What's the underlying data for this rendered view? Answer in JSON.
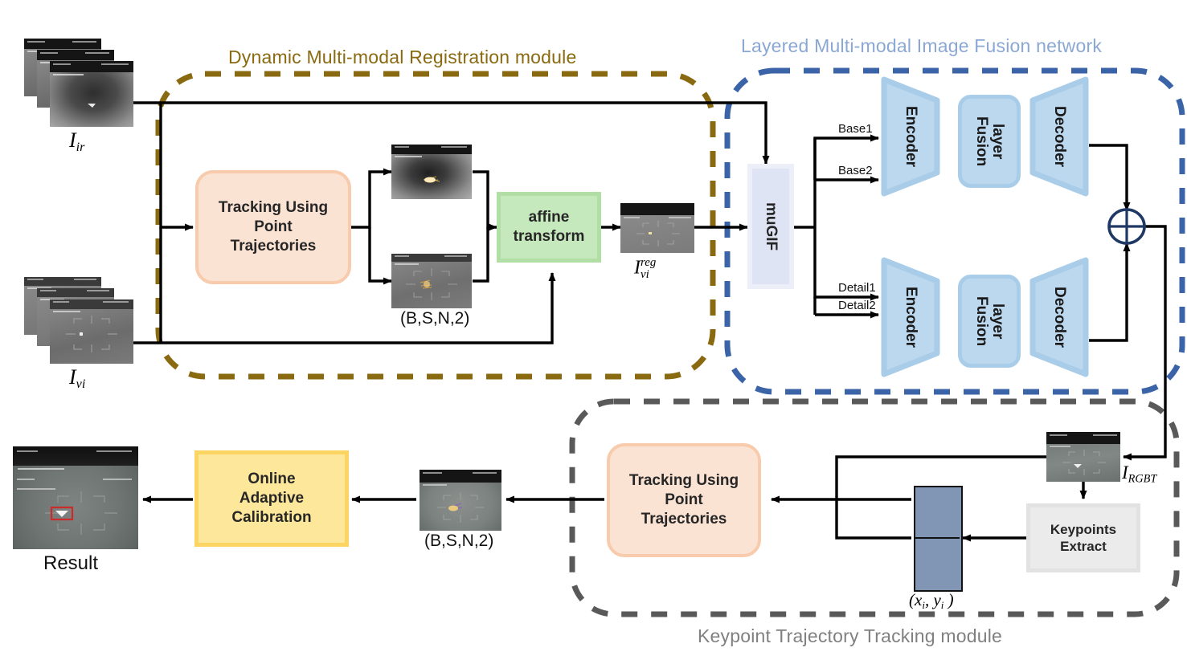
{
  "modules": [
    {
      "id": "registration",
      "caption": "Dynamic Multi-modal Registration module",
      "color": "#8a6a10"
    },
    {
      "id": "fusion",
      "caption": "Layered Multi-modal Image Fusion network",
      "color": "#8ba7d4"
    },
    {
      "id": "keypoint",
      "caption": "Keypoint Trajectory Tracking module",
      "color": "#808080"
    }
  ],
  "inputs": {
    "ir_label": "I",
    "ir_sub": "ir",
    "vi_label": "I",
    "vi_sub": "vi"
  },
  "registration": {
    "tracking_box": "Tracking Using Point Trajectories",
    "tracking_line1": "Tracking Using",
    "tracking_line2": "Point",
    "tracking_line3": "Trajectories",
    "affine_line1": "affine",
    "affine_line2": "transform",
    "tensor_label": "(B,S,N,2)",
    "reg_label": "I",
    "reg_sub": "vi",
    "reg_sup": "reg"
  },
  "fusion": {
    "mugif_label": "muGIF",
    "edge_labels": [
      "Base1",
      "Base2",
      "Detail1",
      "Detail2"
    ],
    "encoder_label": "Encoder",
    "fusion_layer_line1": "Fusion",
    "fusion_layer_line2": "layer",
    "decoder_label": "Decoder",
    "sum_symbol": "+",
    "output_label": "I",
    "output_sub": "RGBT"
  },
  "keypoint": {
    "tracking_line1": "Tracking Using",
    "tracking_line2": "Point",
    "tracking_line3": "Trajectories",
    "keypoints_line1": "Keypoints",
    "keypoints_line2": "Extract",
    "coords_label": "(x",
    "coords_sub1": "i",
    "coords_mid": ", y",
    "coords_sub2": "i",
    "coords_end": " )",
    "tensor_label": "(B,S,N,2)"
  },
  "output": {
    "calibration_line1": "Online",
    "calibration_line2": "Adaptive",
    "calibration_line3": "Calibration",
    "result_label": "Result"
  },
  "colors": {
    "olive_dash": "#8a6a10",
    "blue_dash": "#3a63a8",
    "gray_dash": "#595959",
    "peach_fill": "#fbe3d4",
    "peach_stroke": "#f7cbab",
    "green_fill": "#c5e8bd",
    "yellow_fill": "#fde79b",
    "blue_shape": "#bcd8ef",
    "blue_shape_stroke": "#a9cde9",
    "mugif_fill": "#dee4f3",
    "gray_fill": "#ebebeb",
    "slate_block": "#8195b4",
    "edge": "#000000"
  }
}
